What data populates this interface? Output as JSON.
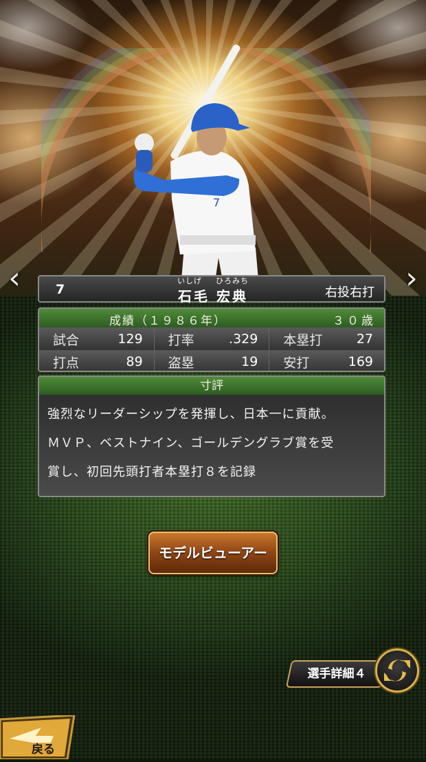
{
  "player": {
    "number": "7",
    "ruby_family": "いしげ",
    "ruby_given": "ひろみち",
    "name": "石毛 宏典",
    "throw_bat": "右投右打"
  },
  "stats": {
    "title": "成績（１９８６年）",
    "age": "３０歳",
    "rows": [
      [
        {
          "label": "試合",
          "value": "129"
        },
        {
          "label": "打率",
          "value": ".329"
        },
        {
          "label": "本塁打",
          "value": "27"
        }
      ],
      [
        {
          "label": "打点",
          "value": "89"
        },
        {
          "label": "盗塁",
          "value": "19"
        },
        {
          "label": "安打",
          "value": "169"
        }
      ]
    ]
  },
  "comment": {
    "title": "寸評",
    "lines": [
      "強烈なリーダーシップを発揮し、日本一に貢献。",
      "ＭＶＰ、ベストナイン、ゴールデングラブ賞を受",
      "賞し、初回先頭打者本塁打８を記録"
    ]
  },
  "buttons": {
    "model_viewer": "モデルビューアー",
    "player_detail": "選手詳細４",
    "back": "戻る"
  },
  "nav": {
    "prev": "‹",
    "next": "›"
  },
  "colors": {
    "header_green": "#3e7a2e",
    "button_brown": "#8e4515",
    "gold_border": "#d9b24a"
  }
}
